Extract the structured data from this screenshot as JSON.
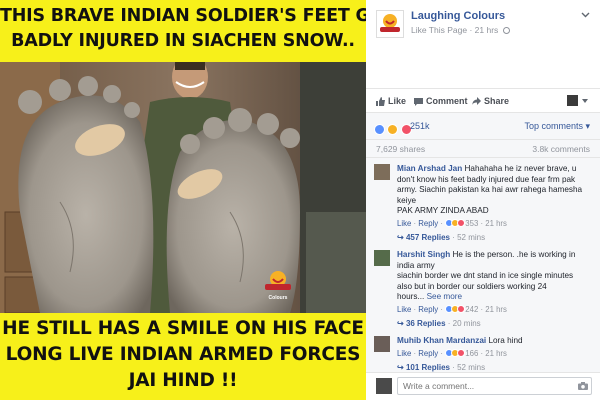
{
  "meme": {
    "top_lines": [
      "THIS BRAVE INDIAN SOLDIER'S FEET GOT",
      "BADLY INJURED IN SIACHEN SNOW.."
    ],
    "bottom_lines": [
      "HE STILL HAS A SMILE ON HIS FACE",
      "LONG LIVE INDIAN ARMED FORCES",
      "JAI HIND !!"
    ],
    "watermark_text": "Colours",
    "banner_color": "#f7f01a"
  },
  "post": {
    "page_name": "Laughing Colours",
    "like_page": "Like This Page",
    "time": "21 hrs",
    "actions": {
      "like": "Like",
      "comment": "Comment",
      "share": "Share"
    },
    "reaction_count": "251k",
    "top_comments": "Top comments",
    "shares": "7,629 shares",
    "comments_count": "3.8k comments"
  },
  "comments": [
    {
      "name": "Mian Arshad Jan",
      "lines": [
        "Hahahaha he iz never brave, u",
        "don't know his feet badly injured due fear frm pak",
        "army. Siachin pakistan ka hai awr rahega hamesha",
        "keiye",
        "PAK ARMY ZINDA ABAD"
      ],
      "like": "Like",
      "reply": "Reply",
      "reactions": "353",
      "time": "21 hrs",
      "replies": "457 Replies",
      "replies_time": "52 mins"
    },
    {
      "name": "Harshit Singh",
      "lines": [
        "He is the person. .he is working in",
        "india army",
        "siachin border we dnt stand in ice single minutes",
        "also but in border our soldiers working 24",
        "hours..."
      ],
      "see_more": "See more",
      "like": "Like",
      "reply": "Reply",
      "reactions": "242",
      "time": "21 hrs",
      "replies": "36 Replies",
      "replies_time": "20 mins"
    },
    {
      "name": "Muhib Khan Mardanzai",
      "lines": [
        "Lora hind"
      ],
      "like": "Like",
      "reply": "Reply",
      "reactions": "166",
      "time": "21 hrs",
      "replies": "101 Replies",
      "replies_time": "52 mins"
    }
  ],
  "composer": {
    "placeholder": "Write a comment..."
  },
  "colors": {
    "link": "#365899",
    "meta": "#90949c",
    "like_blue": "#5890ff",
    "love_red": "#f25268",
    "haha_yellow": "#f7b125"
  }
}
